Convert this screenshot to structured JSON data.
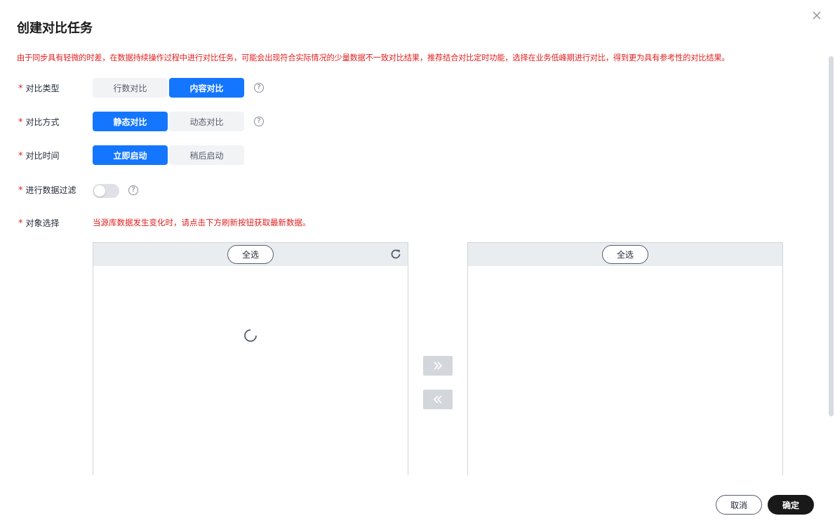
{
  "dialog": {
    "title": "创建对比任务"
  },
  "notice": "由于同步具有轻微的时差，在数据持续操作过程中进行对比任务，可能会出现符合实际情况的少量数据不一致对比结果，推荐结合对比定时功能，选择在业务低峰期进行对比，得到更为具有参考性的对比结果。",
  "form": {
    "required_mark": "*",
    "compare_type": {
      "label": "对比类型",
      "options": [
        "行数对比",
        "内容对比"
      ],
      "selected": "内容对比"
    },
    "compare_mode": {
      "label": "对比方式",
      "options": [
        "静态对比",
        "动态对比"
      ],
      "selected": "静态对比"
    },
    "compare_time": {
      "label": "对比时间",
      "options": [
        "立即启动",
        "稍后启动"
      ],
      "selected": "立即启动"
    },
    "data_filter": {
      "label": "进行数据过滤",
      "enabled": false
    },
    "object_select": {
      "label": "对象选择",
      "hint": "当源库数据发生变化时，请点击下方刷新按钮获取最新数据。",
      "left_panel": {
        "select_all": "全选",
        "loading": true
      },
      "right_panel": {
        "select_all": "全选"
      }
    },
    "help_glyph": "?"
  },
  "footer": {
    "cancel": "取消",
    "confirm": "确定"
  },
  "colors": {
    "primary": "#1476ff",
    "danger": "#e02020",
    "dark": "#191919"
  }
}
